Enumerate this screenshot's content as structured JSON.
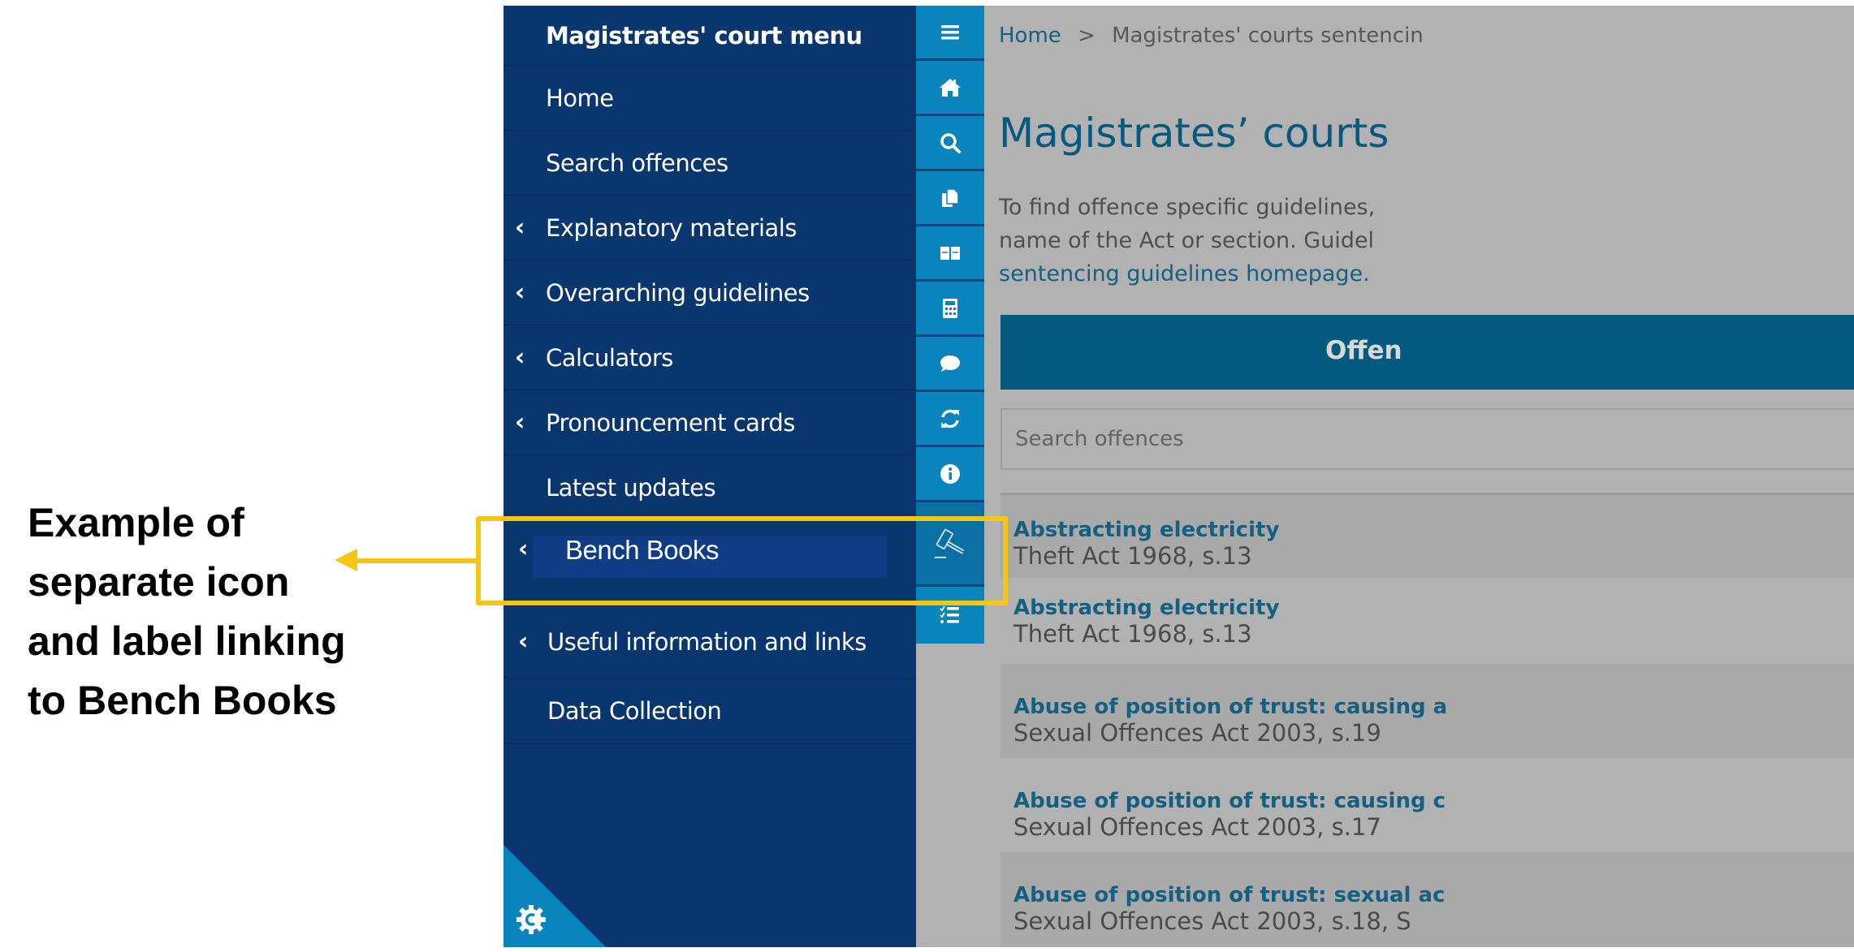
{
  "annotation": {
    "lines": [
      "Example of",
      "separate icon",
      "and label linking",
      "to Bench Books"
    ],
    "accent_color": "#F5C518"
  },
  "sidebar": {
    "title": "Magistrates' court menu",
    "items": [
      {
        "label": "Home",
        "has_chevron": false
      },
      {
        "label": "Search offences",
        "has_chevron": false
      },
      {
        "label": "Explanatory materials",
        "has_chevron": true
      },
      {
        "label": "Overarching guidelines",
        "has_chevron": true
      },
      {
        "label": "Calculators",
        "has_chevron": true
      },
      {
        "label": "Pronouncement cards",
        "has_chevron": true
      },
      {
        "label": "Latest updates",
        "has_chevron": false
      },
      {
        "label": "Bench Books",
        "has_chevron": true,
        "highlighted": true
      },
      {
        "label": "Useful information and links",
        "has_chevron": true
      },
      {
        "label": "Data Collection",
        "has_chevron": false
      }
    ],
    "chevron_glyph": "‹",
    "settings_icon": "gear-icon",
    "colors": {
      "background": "#0a3670",
      "icon_strip": "#0a84bd"
    }
  },
  "iconbar": {
    "icons": [
      "menu-icon",
      "home-icon",
      "search-icon",
      "documents-icon",
      "book-icon",
      "calculator-icon",
      "speech-bubble-icon",
      "refresh-icon",
      "info-icon",
      "gavel-icon",
      "checklist-icon"
    ]
  },
  "main": {
    "breadcrumb": {
      "home": "Home",
      "separator": ">",
      "current": "Magistrates' courts sentencin"
    },
    "title": "Magistrates’ courts",
    "intro": {
      "line1": "To find offence specific guidelines,",
      "line2": "name of the Act or section. Guidel",
      "link": "sentencing guidelines homepage."
    },
    "offences_header": "Offen",
    "search": {
      "placeholder": "Search offences",
      "value": ""
    },
    "results": [
      {
        "title": "Abstracting electricity",
        "act": "Theft Act 1968, s.13"
      },
      {
        "title": "Abstracting electricity",
        "act": "Theft Act 1968, s.13"
      },
      {
        "title": "Abuse of position of trust: causing a",
        "act": "Sexual Offences Act 2003, s.19"
      },
      {
        "title": "Abuse of position of trust: causing c",
        "act": "Sexual Offences Act 2003, s.17"
      },
      {
        "title": "Abuse of position of trust: sexual ac",
        "act": "Sexual Offences Act 2003, s.18, S"
      }
    ],
    "colors": {
      "title": "#05587f",
      "link": "#155f80",
      "header_bar": "#035a7c",
      "overlay": "#b2b2b2"
    }
  }
}
